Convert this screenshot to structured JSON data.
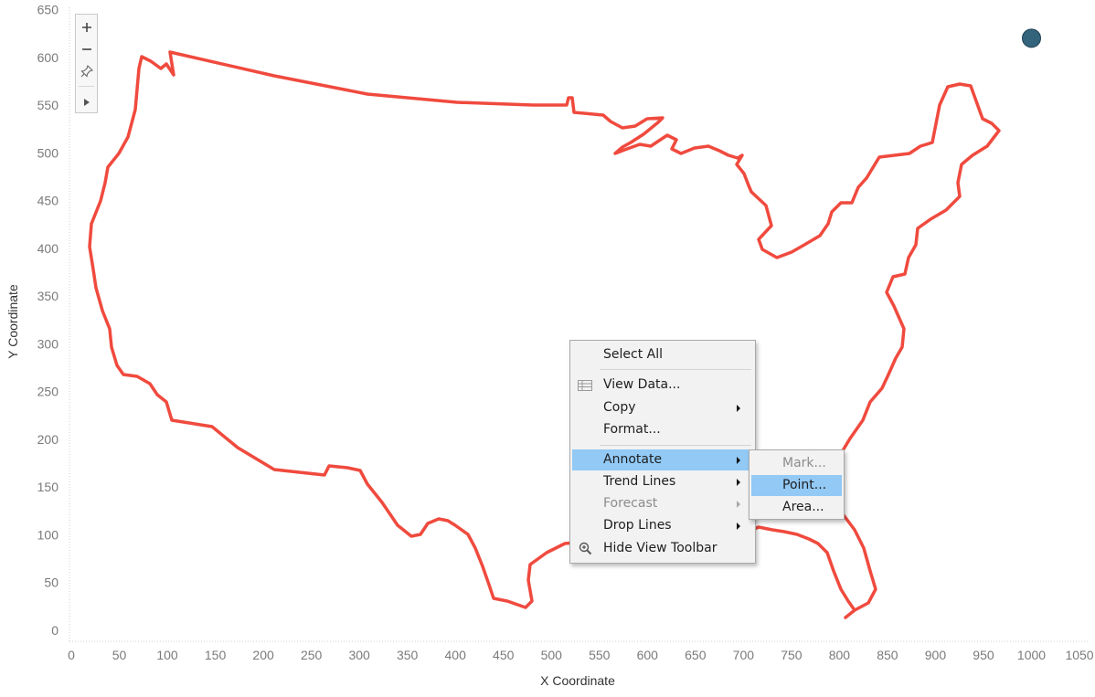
{
  "chart_data": {
    "type": "map",
    "xlabel": "X Coordinate",
    "ylabel": "Y Coordinate",
    "xlim": [
      0,
      1050
    ],
    "ylim": [
      0,
      650
    ],
    "x_ticks": [
      "0",
      "50",
      "100",
      "150",
      "200",
      "250",
      "300",
      "350",
      "400",
      "450",
      "500",
      "550",
      "600",
      "650",
      "700",
      "750",
      "800",
      "850",
      "900",
      "950",
      "1000",
      "1050"
    ],
    "y_ticks": [
      "0",
      "50",
      "100",
      "150",
      "200",
      "250",
      "300",
      "350",
      "400",
      "450",
      "500",
      "550",
      "600",
      "650"
    ],
    "points": [
      {
        "x": 1000,
        "y": 620,
        "color": "#33647c"
      }
    ],
    "outline_color": "#f04a3e"
  },
  "toolbar": {
    "zoom_in_icon": "plus-icon",
    "zoom_out_icon": "minus-icon",
    "pin_icon": "pin-icon",
    "expand_icon": "play-icon"
  },
  "context_menu": {
    "select_all": "Select All",
    "view_data": "View Data...",
    "copy": "Copy",
    "format": "Format...",
    "annotate": "Annotate",
    "trend_lines": "Trend Lines",
    "forecast": "Forecast",
    "drop_lines": "Drop Lines",
    "hide_view_toolbar": "Hide View Toolbar",
    "highlight_color": "#92c9f5"
  },
  "annotate_submenu": {
    "mark": "Mark...",
    "point": "Point...",
    "area": "Area..."
  }
}
